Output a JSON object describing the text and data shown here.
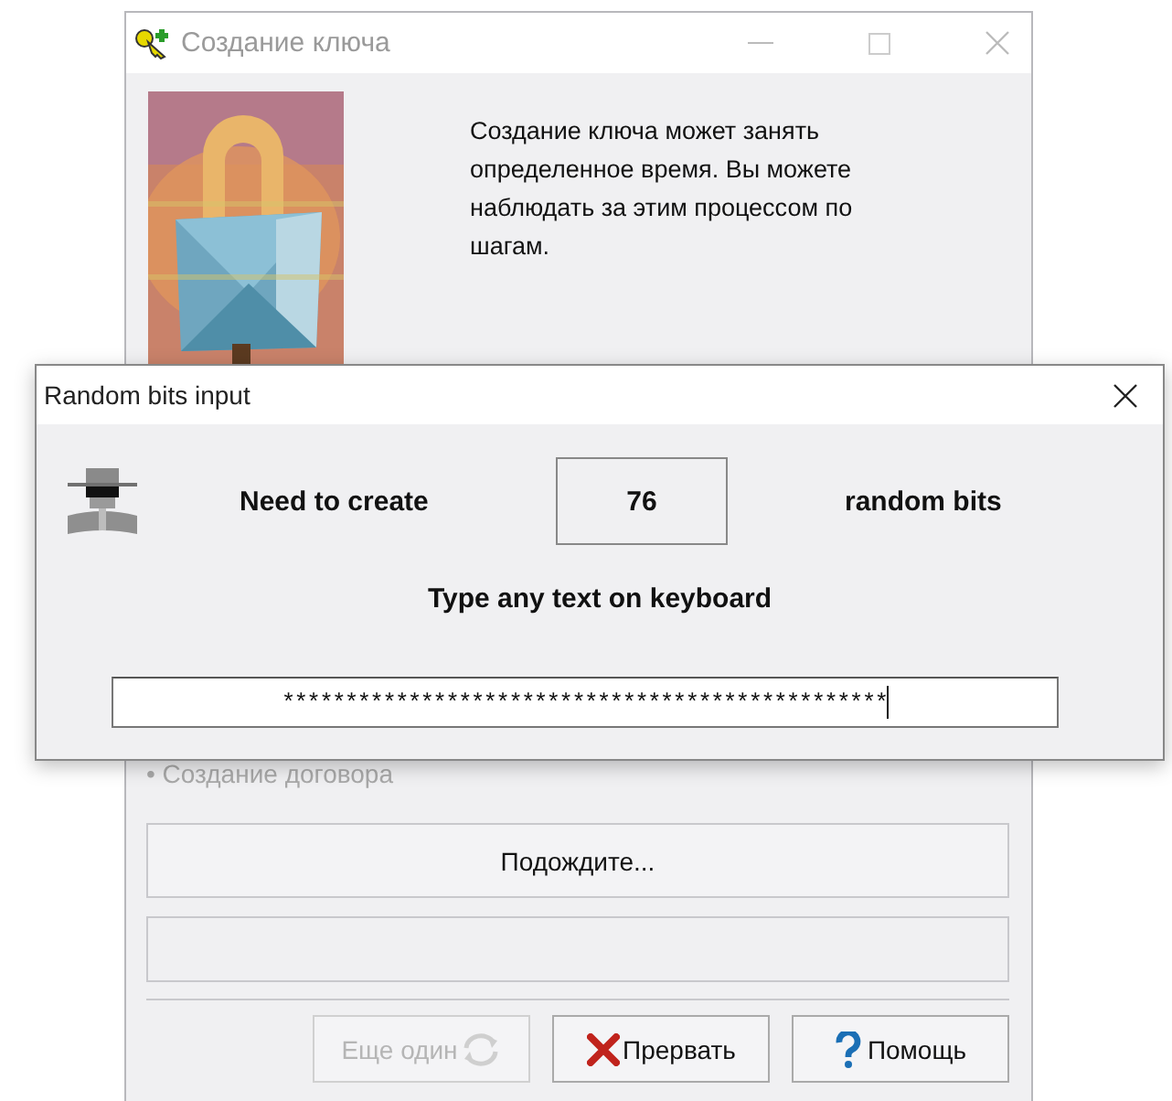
{
  "background_window": {
    "title": "Создание ключа",
    "description": "Создание ключа может занять определенное время. Вы можете наблюдать за этим процессом по шагам.",
    "step": "• Создание договора",
    "status_button": "Подождите...",
    "buttons": [
      {
        "label": "Еще один",
        "kind": "repeat",
        "disabled": true
      },
      {
        "label": "Прервать",
        "kind": "abort",
        "disabled": false
      },
      {
        "label": "Помощь",
        "kind": "help",
        "disabled": false
      }
    ]
  },
  "dialog": {
    "title": "Random bits input",
    "need_label": "Need to create",
    "bits_count": "76",
    "bits_label": "random bits",
    "instruction": "Type any text on keyboard",
    "input_value": "************************************************"
  }
}
